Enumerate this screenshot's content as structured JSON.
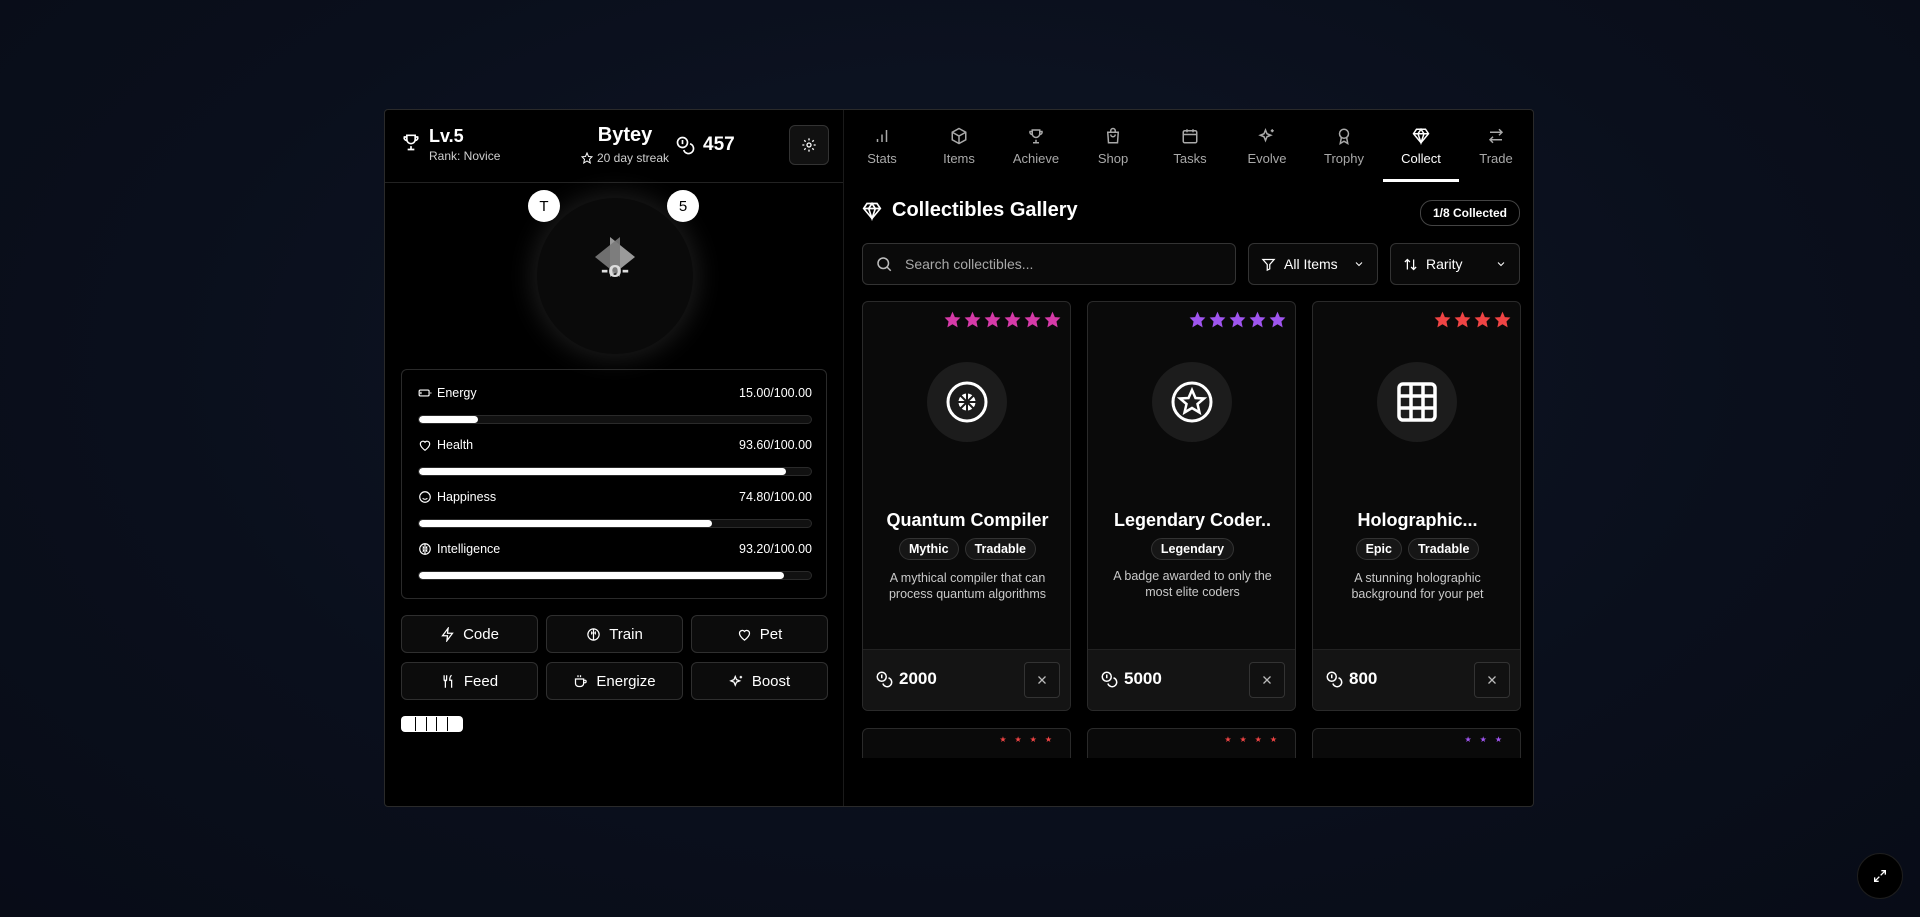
{
  "header": {
    "level": "Lv.5",
    "rank": "Rank: Novice",
    "pet_name": "Bytey",
    "streak": "20 day streak",
    "coins": "457"
  },
  "avatar": {
    "bubble_left": "T",
    "bubble_right": "5",
    "face": "-o-"
  },
  "stats": [
    {
      "label": "Energy",
      "value": "15.00/100.00",
      "pct": 15.0,
      "icon": "battery-icon"
    },
    {
      "label": "Health",
      "value": "93.60/100.00",
      "pct": 93.6,
      "icon": "heart-icon"
    },
    {
      "label": "Happiness",
      "value": "74.80/100.00",
      "pct": 74.8,
      "icon": "smile-icon"
    },
    {
      "label": "Intelligence",
      "value": "93.20/100.00",
      "pct": 93.2,
      "icon": "brain-icon"
    }
  ],
  "actions": [
    {
      "label": "Code",
      "icon": "bolt-icon"
    },
    {
      "label": "Train",
      "icon": "brain-icon"
    },
    {
      "label": "Pet",
      "icon": "heart-icon"
    },
    {
      "label": "Feed",
      "icon": "utensils-icon"
    },
    {
      "label": "Energize",
      "icon": "coffee-icon"
    },
    {
      "label": "Boost",
      "icon": "sparkles-icon"
    }
  ],
  "tabs": [
    {
      "label": "Stats",
      "icon": "bar-chart-icon"
    },
    {
      "label": "Items",
      "icon": "box-icon"
    },
    {
      "label": "Achieve",
      "icon": "trophy-icon"
    },
    {
      "label": "Shop",
      "icon": "shopping-bag-icon"
    },
    {
      "label": "Tasks",
      "icon": "calendar-icon"
    },
    {
      "label": "Evolve",
      "icon": "sparkles-icon"
    },
    {
      "label": "Trophy",
      "icon": "award-icon"
    },
    {
      "label": "Collect",
      "icon": "gem-icon",
      "active": true
    },
    {
      "label": "Trade",
      "icon": "arrows-swap-icon"
    }
  ],
  "gallery": {
    "title": "Collectibles Gallery",
    "collected": "1/8 Collected",
    "search_placeholder": "Search collectibles...",
    "filter_label": "All Items",
    "sort_label": "Rarity"
  },
  "cards": [
    {
      "name": "Quantum Compiler",
      "tags": [
        "Mythic",
        "Tradable"
      ],
      "desc": "A mythical compiler that can process quantum algorithms",
      "price": "2000",
      "stars": 6,
      "star_color": "#d63aa8",
      "icon": "quantum-chip-icon"
    },
    {
      "name": "Legendary Coder..",
      "tags": [
        "Legendary"
      ],
      "desc": "A badge awarded to only the most elite coders",
      "price": "5000",
      "stars": 5,
      "star_color": "#a055f0",
      "icon": "star-badge-icon"
    },
    {
      "name": "Holographic...",
      "tags": [
        "Epic",
        "Tradable"
      ],
      "desc": "A stunning holographic background for your pet",
      "price": "800",
      "stars": 4,
      "star_color": "#ef4444",
      "icon": "grid-icon"
    }
  ]
}
